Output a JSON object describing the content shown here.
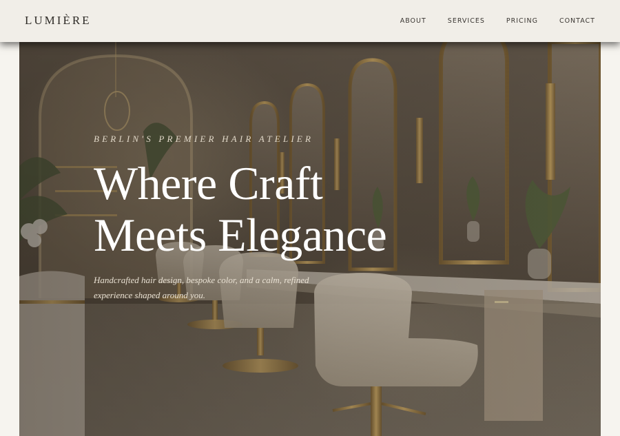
{
  "brand": {
    "name": "LUMIÈRE"
  },
  "nav": {
    "items": [
      {
        "label": "ABOUT"
      },
      {
        "label": "SERVICES"
      },
      {
        "label": "PRICING"
      },
      {
        "label": "CONTACT"
      }
    ]
  },
  "hero": {
    "eyebrow": "BERLIN'S PREMIER HAIR ATELIER",
    "headline_line1": "Where Craft",
    "headline_line2": "Meets Elegance",
    "subtext": "Handcrafted hair design, bespoke color, and a calm, refined experience shaped around you."
  },
  "colors": {
    "header_bg": "#f1eee8",
    "page_bg": "#f6f4ef",
    "text_dark": "#2d2a26",
    "gold_accent": "#b8904a",
    "hero_text": "#ffffff"
  }
}
